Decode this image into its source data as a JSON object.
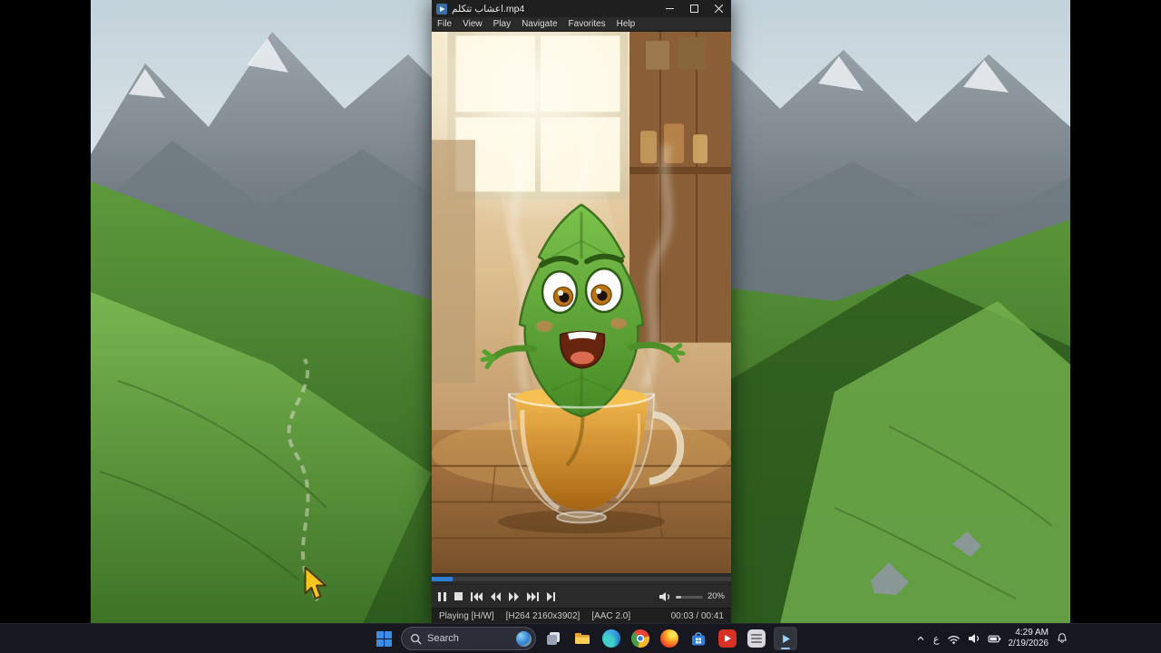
{
  "window": {
    "title": "اعشاب تتكلم.mp4",
    "menu": [
      "File",
      "View",
      "Play",
      "Navigate",
      "Favorites",
      "Help"
    ]
  },
  "playback": {
    "progress_width": "7%",
    "volume_fill_width": "20%",
    "volume_label": "20%",
    "status_state": "Playing [H/W]",
    "status_video": "[H264 2160x3902]",
    "status_audio": "[AAC 2.0]",
    "status_time": "00:03 / 00:41"
  },
  "taskbar": {
    "search_label": "Search",
    "language_indicator": "ع",
    "clock_time": "4:29 AM",
    "clock_date": "2/19/2026"
  },
  "colors": {
    "accent_blue": "#2f7ed4",
    "tea_amber": "#d99a2b",
    "leaf_green": "#57a332",
    "taskbar_bg": "#17171f"
  }
}
